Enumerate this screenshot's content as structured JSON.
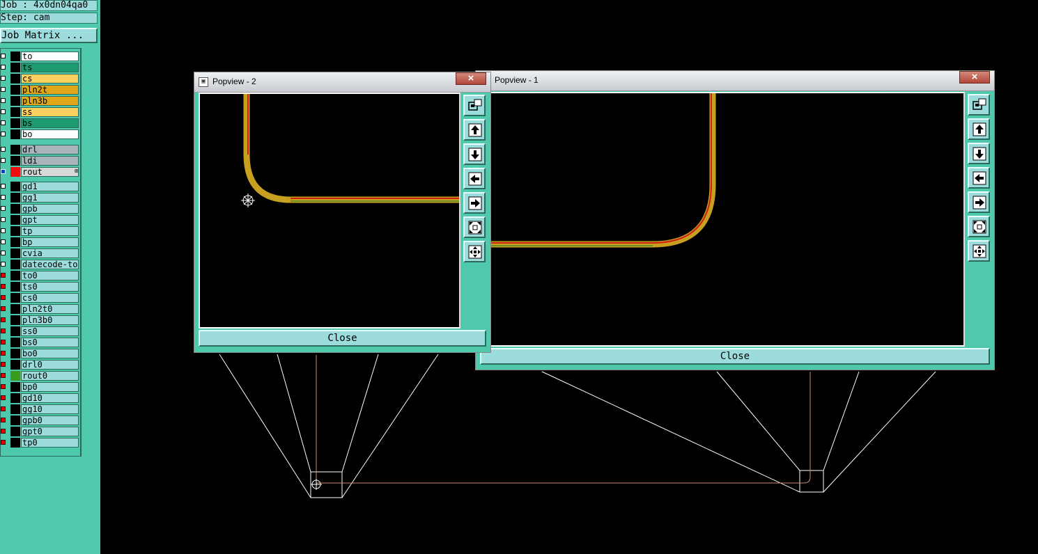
{
  "job_label": "Job : 4x0dn04qa0",
  "step_label": "Step: cam",
  "job_matrix_button": "Job Matrix ...",
  "colors": {
    "panel": "#4fc9ac",
    "name_bg": "#9ddcdc",
    "trace_outer": "#c8a020",
    "trace_inner_red": "#d02010",
    "trace_inner_green": "#6a8e20"
  },
  "layers_board": [
    {
      "name": "to",
      "bg": "#ffffff",
      "swatch": "#000000",
      "state": "off"
    },
    {
      "name": "ts",
      "bg": "#1e9a70",
      "swatch": "#000000",
      "state": "off"
    },
    {
      "name": "cs",
      "bg": "#ffd060",
      "swatch": "#000000",
      "state": "off"
    },
    {
      "name": "pln2t",
      "bg": "#e0a818",
      "swatch": "#000000",
      "state": "off"
    },
    {
      "name": "pln3b",
      "bg": "#e0a818",
      "swatch": "#000000",
      "state": "off"
    },
    {
      "name": "ss",
      "bg": "#ffd060",
      "swatch": "#000000",
      "state": "off"
    },
    {
      "name": "bs",
      "bg": "#1e9a70",
      "swatch": "#000000",
      "state": "off"
    },
    {
      "name": "bo",
      "bg": "#ffffff",
      "swatch": "#000000",
      "state": "off"
    }
  ],
  "layers_drill": [
    {
      "name": "drl",
      "bg": "#a8b4b8",
      "swatch": "#000000",
      "state": "off"
    },
    {
      "name": "ldi",
      "bg": "#a8b4b8",
      "swatch": "#000000",
      "state": "off"
    },
    {
      "name": "rout",
      "bg": "#d8d8d8",
      "swatch": "#ee1010",
      "state": "sel",
      "mark": "⊞"
    }
  ],
  "layers_misc": [
    {
      "name": "gd1",
      "bg": "#9ddcdc",
      "swatch": "#000000",
      "state": "off"
    },
    {
      "name": "gg1",
      "bg": "#9ddcdc",
      "swatch": "#000000",
      "state": "off"
    },
    {
      "name": "gpb",
      "bg": "#9ddcdc",
      "swatch": "#000000",
      "state": "off"
    },
    {
      "name": "gpt",
      "bg": "#9ddcdc",
      "swatch": "#000000",
      "state": "off"
    },
    {
      "name": "tp",
      "bg": "#9ddcdc",
      "swatch": "#000000",
      "state": "off"
    },
    {
      "name": "bp",
      "bg": "#9ddcdc",
      "swatch": "#000000",
      "state": "off"
    },
    {
      "name": "cvia",
      "bg": "#9ddcdc",
      "swatch": "#000000",
      "state": "off"
    },
    {
      "name": "datecode-to",
      "bg": "#9ddcdc",
      "swatch": "#000000",
      "state": "off"
    },
    {
      "name": "to0",
      "bg": "#9ddcdc",
      "swatch": "#000000",
      "state": "on"
    },
    {
      "name": "ts0",
      "bg": "#9ddcdc",
      "swatch": "#000000",
      "state": "on"
    },
    {
      "name": "cs0",
      "bg": "#9ddcdc",
      "swatch": "#000000",
      "state": "on"
    },
    {
      "name": "pln2t0",
      "bg": "#9ddcdc",
      "swatch": "#000000",
      "state": "on"
    },
    {
      "name": "pln3b0",
      "bg": "#9ddcdc",
      "swatch": "#000000",
      "state": "on"
    },
    {
      "name": "ss0",
      "bg": "#9ddcdc",
      "swatch": "#000000",
      "state": "on"
    },
    {
      "name": "bs0",
      "bg": "#9ddcdc",
      "swatch": "#000000",
      "state": "on"
    },
    {
      "name": "bo0",
      "bg": "#9ddcdc",
      "swatch": "#000000",
      "state": "on"
    },
    {
      "name": "drl0",
      "bg": "#9ddcdc",
      "swatch": "#000000",
      "state": "on"
    },
    {
      "name": "rout0",
      "bg": "#9ddcdc",
      "swatch": "#3a9a20",
      "state": "on"
    },
    {
      "name": "bp0",
      "bg": "#9ddcdc",
      "swatch": "#000000",
      "state": "on"
    },
    {
      "name": "gd10",
      "bg": "#9ddcdc",
      "swatch": "#000000",
      "state": "on"
    },
    {
      "name": "gg10",
      "bg": "#9ddcdc",
      "swatch": "#000000",
      "state": "on"
    },
    {
      "name": "gpb0",
      "bg": "#9ddcdc",
      "swatch": "#000000",
      "state": "on"
    },
    {
      "name": "gpt0",
      "bg": "#9ddcdc",
      "swatch": "#000000",
      "state": "on"
    },
    {
      "name": "tp0",
      "bg": "#9ddcdc",
      "swatch": "#000000",
      "state": "on"
    }
  ],
  "popview2": {
    "title": "Popview - 2",
    "close_label": "Close",
    "close_x": "×"
  },
  "popview1": {
    "title": "Popview - 1",
    "close_label": "Close",
    "close_x": "×"
  },
  "toolbar_icons": [
    "zoom-window-icon",
    "pan-up-icon",
    "pan-down-icon",
    "pan-left-icon",
    "pan-right-icon",
    "zoom-fit-icon",
    "zoom-center-icon"
  ]
}
